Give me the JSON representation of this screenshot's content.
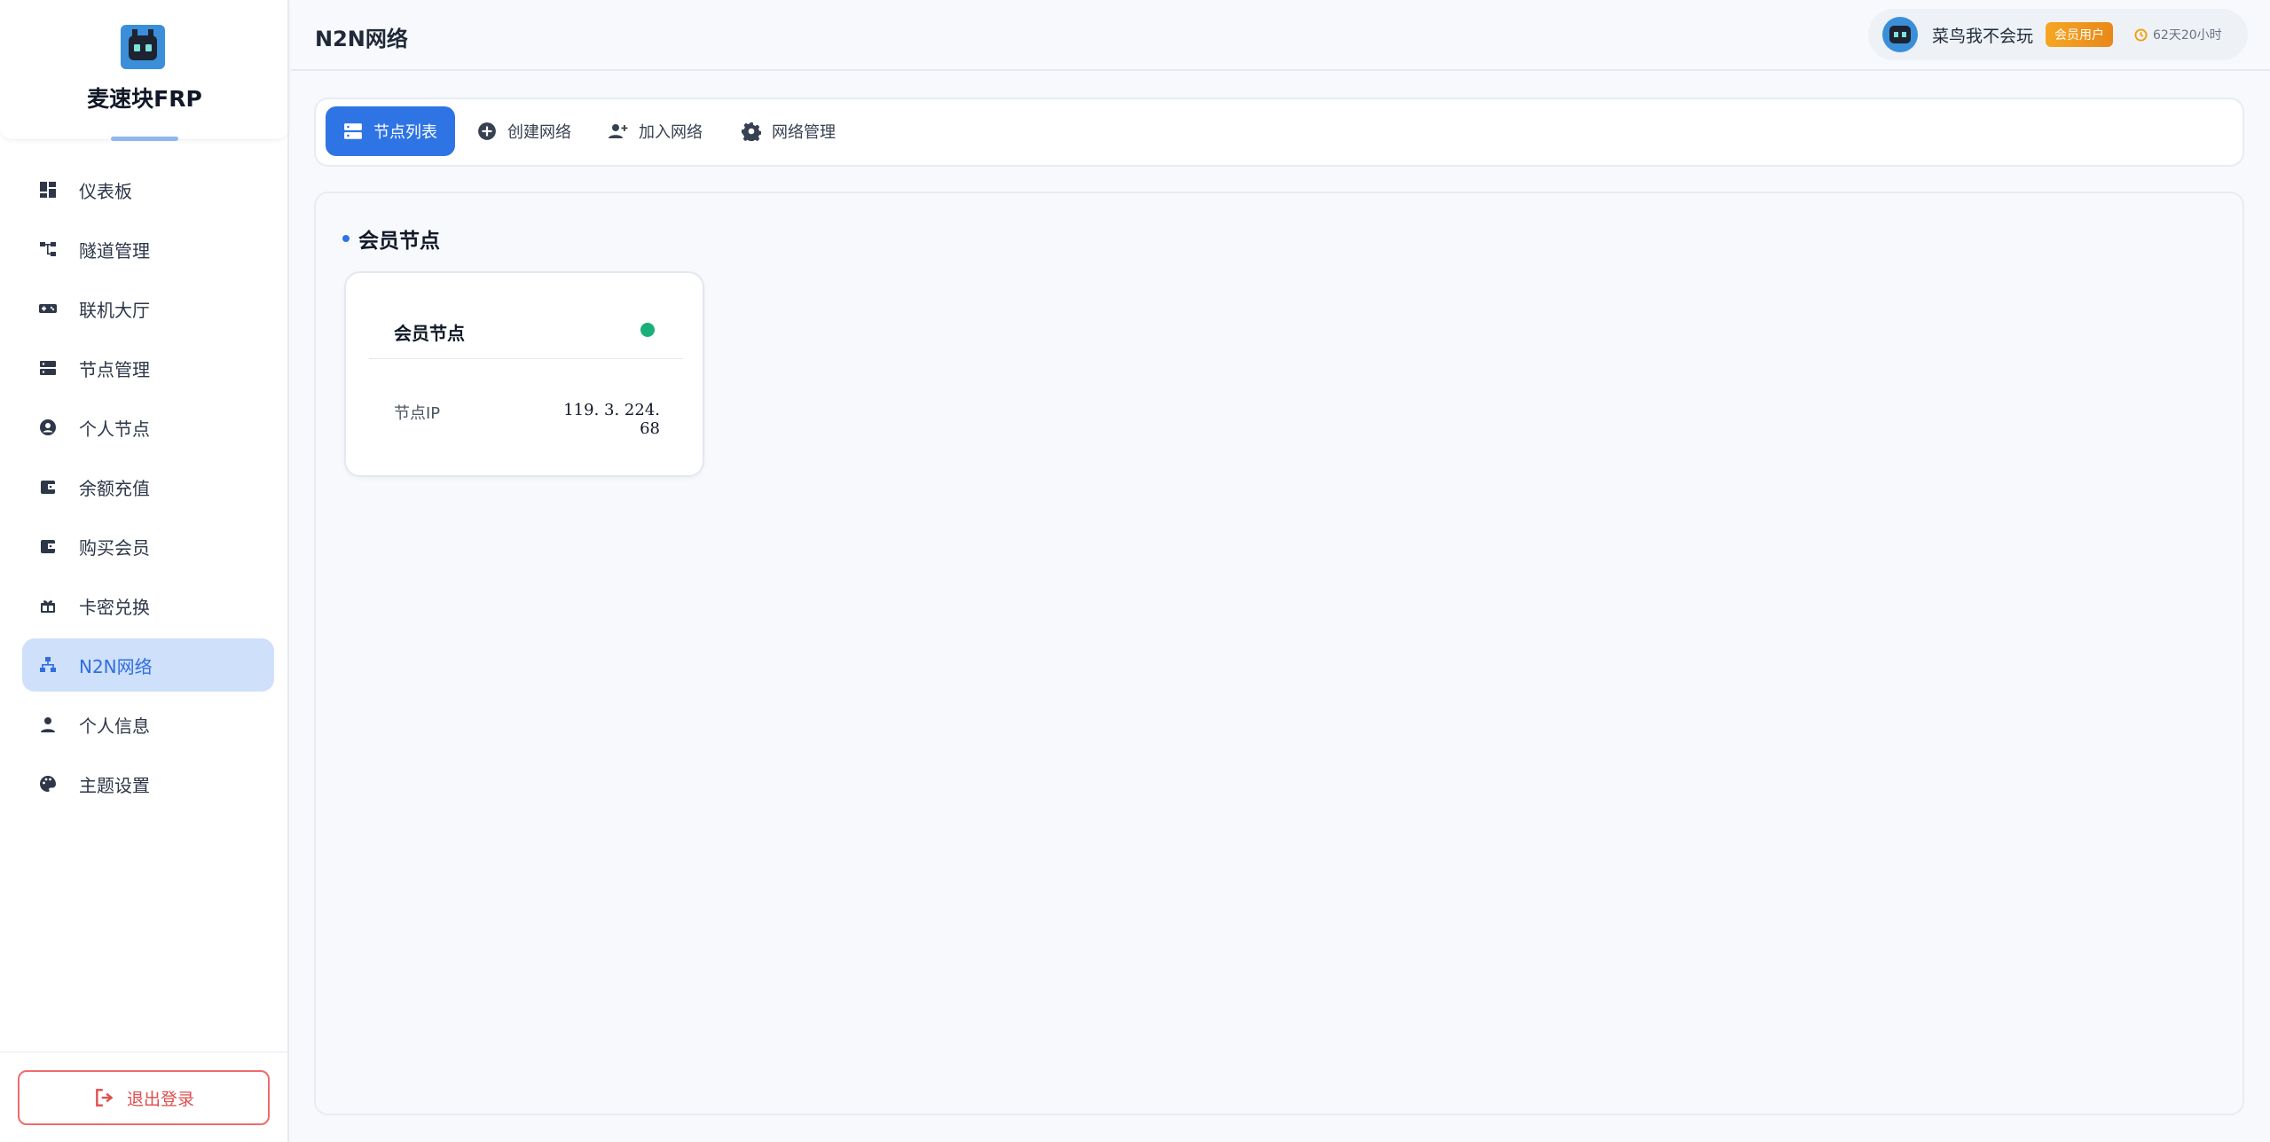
{
  "brand": {
    "name": "麦速块FRP"
  },
  "sidebar": {
    "items": [
      {
        "label": "仪表板",
        "icon": "dashboard-icon"
      },
      {
        "label": "隧道管理",
        "icon": "tunnel-icon"
      },
      {
        "label": "联机大厅",
        "icon": "gamepad-icon"
      },
      {
        "label": "节点管理",
        "icon": "server-icon"
      },
      {
        "label": "个人节点",
        "icon": "user-circle-icon"
      },
      {
        "label": "余额充值",
        "icon": "wallet-icon"
      },
      {
        "label": "购买会员",
        "icon": "wallet-icon"
      },
      {
        "label": "卡密兑换",
        "icon": "gift-icon"
      },
      {
        "label": "N2N网络",
        "icon": "network-icon",
        "active": true
      },
      {
        "label": "个人信息",
        "icon": "user-icon"
      },
      {
        "label": "主题设置",
        "icon": "palette-icon"
      }
    ],
    "logout_label": "退出登录"
  },
  "header": {
    "title": "N2N网络",
    "user": {
      "name": "菜鸟我不会玩",
      "badge": "会员用户",
      "expire": "62天20小时"
    }
  },
  "tabs": [
    {
      "label": "节点列表",
      "icon": "server-icon",
      "active": true
    },
    {
      "label": "创建网络",
      "icon": "plus-circle-icon"
    },
    {
      "label": "加入网络",
      "icon": "user-plus-icon"
    },
    {
      "label": "网络管理",
      "icon": "gear-icon"
    }
  ],
  "main": {
    "section_title": "会员节点",
    "nodes": [
      {
        "name": "会员节点",
        "status": "online",
        "ip_label": "节点IP",
        "ip": "119. 3. 224. 68"
      }
    ]
  },
  "colors": {
    "accent": "#2f74e4",
    "active_bg": "#cfe0fb",
    "online": "#18b07a",
    "danger": "#e14d4d",
    "vip": "#f6a623"
  }
}
